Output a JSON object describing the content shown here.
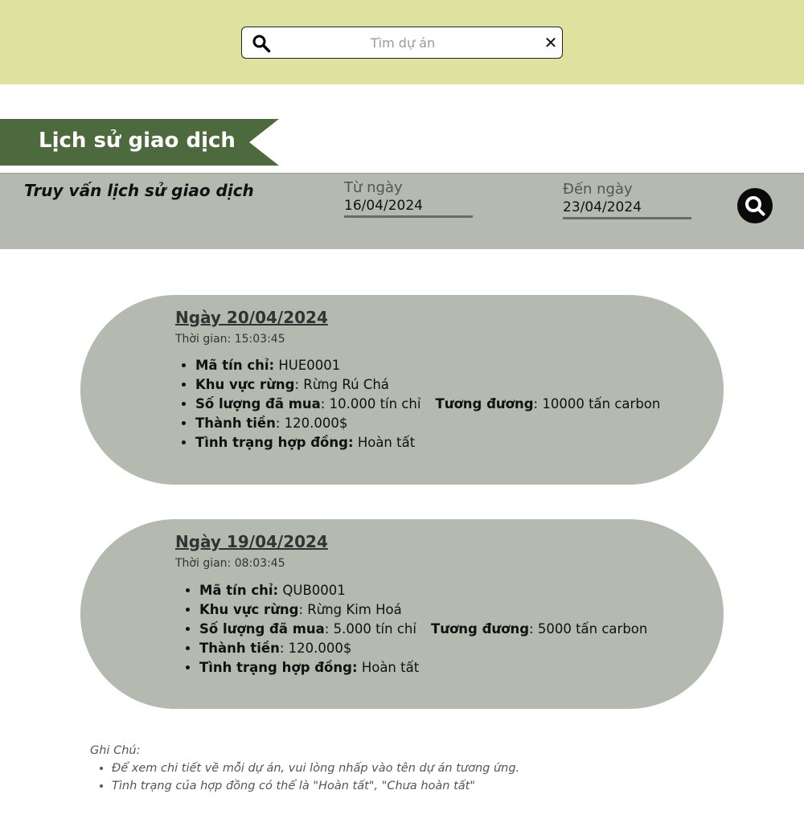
{
  "search": {
    "placeholder": "Tìm dự án",
    "search_icon": "search-icon",
    "clear_icon": "close-icon",
    "clear_glyph": "✕"
  },
  "section": {
    "title": "Lịch sử giao dịch",
    "ribbon_color": "#4d6a3e"
  },
  "query": {
    "title": "Truy vấn lịch sử giao dịch",
    "from_label": "Từ ngày",
    "from_value": "16/04/2024",
    "to_label": "Đến ngày",
    "to_value": "23/04/2024",
    "submit_icon": "search-icon"
  },
  "labels": {
    "code": "Mã tín chỉ:",
    "area": "Khu vực rừng",
    "qty": "Số lượng đã mua",
    "equiv": "Tương đương",
    "amount": "Thành tiền",
    "status": "Tình trạng hợp đồng:"
  },
  "transactions": [
    {
      "date": "Ngày 20/04/2024",
      "time": "Thời gian: 15:03:45",
      "code": "HUE0001",
      "area": ": Rừng Rú Chá",
      "qty": ": 10.000 tín chỉ",
      "equiv": ": 10000 tấn carbon",
      "amount": ": 120.000$",
      "status": "Hoàn tất"
    },
    {
      "date": "Ngày 19/04/2024",
      "time": "Thời gian: 08:03:45",
      "code": "QUB0001",
      "area": ": Rừng Kim Hoá",
      "qty": ": 5.000 tín chỉ",
      "equiv": ": 5000 tấn carbon",
      "amount": ": 120.000$",
      "status": "Hoàn tất"
    }
  ],
  "notes": {
    "title": "Ghi Chú:",
    "items": [
      "Để xem chi tiết về mỗi dự án, vui lòng nhấp vào tên dự án tương ứng.",
      "Tình trạng của hợp đồng có thể là \"Hoàn tất\", \"Chưa hoàn tất\""
    ]
  },
  "colors": {
    "topbar": "#dde39e",
    "panel": "#b4bab0",
    "ribbon": "#4d6a3e"
  }
}
